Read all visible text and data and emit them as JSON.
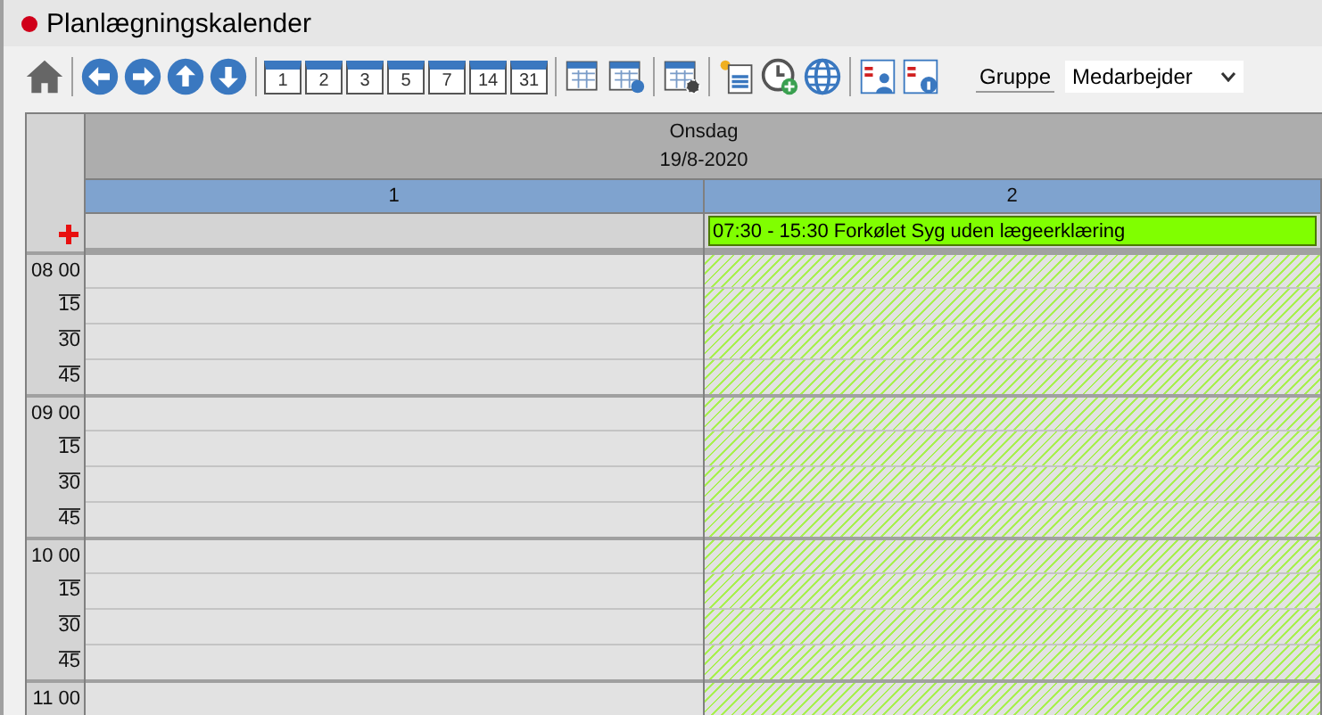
{
  "window": {
    "title": "Planlægningskalender"
  },
  "toolbar": {
    "day_buttons": [
      "1",
      "2",
      "3",
      "5",
      "7",
      "14",
      "31"
    ],
    "group_label": "Gruppe",
    "group_value": "Medarbejder"
  },
  "calendar": {
    "day": "Onsdag",
    "date": "19/8-2020",
    "columns": [
      {
        "label": "1",
        "unavailable": false
      },
      {
        "label": "2",
        "unavailable": true,
        "event": {
          "text": "07:30 - 15:30 Forkølet Syg uden lægeerklæring",
          "color": "#80ff00"
        }
      }
    ],
    "slots": [
      {
        "kind": "hour",
        "label": "08 00"
      },
      {
        "kind": "quarter",
        "label": "15"
      },
      {
        "kind": "quarter",
        "label": "30"
      },
      {
        "kind": "quarter",
        "label": "45"
      },
      {
        "kind": "hour",
        "label": "09 00"
      },
      {
        "kind": "quarter",
        "label": "15"
      },
      {
        "kind": "quarter",
        "label": "30"
      },
      {
        "kind": "quarter",
        "label": "45"
      },
      {
        "kind": "hour",
        "label": "10 00"
      },
      {
        "kind": "quarter",
        "label": "15"
      },
      {
        "kind": "quarter",
        "label": "30"
      },
      {
        "kind": "quarter",
        "label": "45"
      },
      {
        "kind": "hour",
        "label": "11 00"
      }
    ]
  }
}
